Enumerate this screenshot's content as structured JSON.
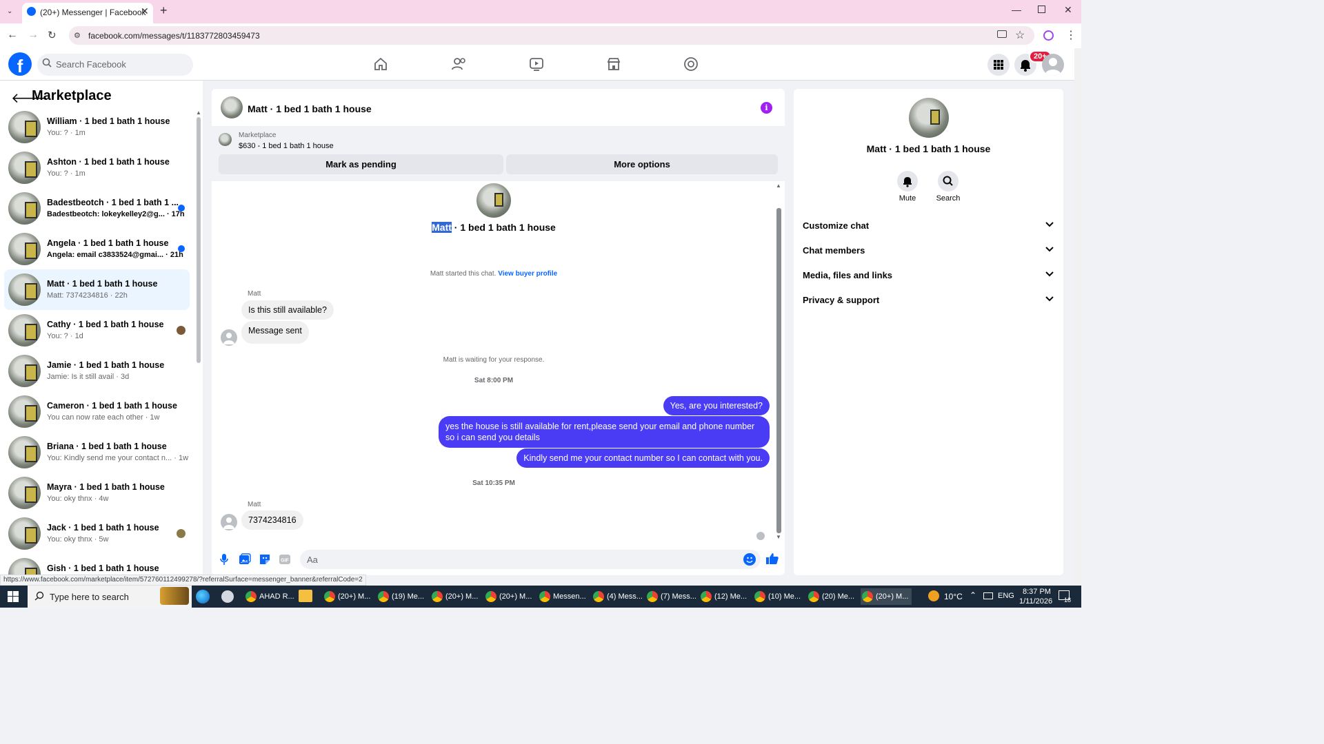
{
  "browser": {
    "tab_title": "(20+) Messenger | Facebook",
    "url": "facebook.com/messages/t/1183772803459473",
    "status_url": "https://www.facebook.com/marketplace/item/572760112499278/?referralSurface=messenger_banner&referralCode=2"
  },
  "header": {
    "search_placeholder": "Search Facebook",
    "notification_badge": "20+"
  },
  "sidebar": {
    "title": "Marketplace",
    "conversations": [
      {
        "name": "William · 1 bed 1 bath 1 house",
        "snippet": "You: ? · 1m",
        "unread": false
      },
      {
        "name": "Ashton · 1 bed 1 bath 1 house",
        "snippet": "You: ? · 1m",
        "unread": false
      },
      {
        "name": "Badestbeotch · 1 bed 1 bath 1 ...",
        "snippet": "Badestbeotch: lokeykelley2@g... · 17h",
        "unread": true
      },
      {
        "name": "Angela · 1 bed 1 bath 1 house",
        "snippet": "Angela: email c3833524@gmai... · 21h",
        "unread": true
      },
      {
        "name": "Matt · 1 bed 1 bath 1 house",
        "snippet": "Matt: 7374234816 · 22h",
        "unread": false
      },
      {
        "name": "Cathy · 1 bed 1 bath 1 house",
        "snippet": "You: ? · 1d",
        "unread": false
      },
      {
        "name": "Jamie · 1 bed 1 bath 1 house",
        "snippet": "Jamie: Is it still avail · 3d",
        "unread": false
      },
      {
        "name": "Cameron · 1 bed 1 bath 1 house",
        "snippet": "You can now rate each other · 1w",
        "unread": false
      },
      {
        "name": "Briana · 1 bed 1 bath 1 house",
        "snippet": "You: Kindly send me your contact n... · 1w",
        "unread": false
      },
      {
        "name": "Mayra · 1 bed 1 bath 1 house",
        "snippet": "You: oky thnx · 4w",
        "unread": false
      },
      {
        "name": "Jack · 1 bed 1 bath 1 house",
        "snippet": "You: oky thnx · 5w",
        "unread": false
      },
      {
        "name": "Gish · 1 bed 1 bath 1 house",
        "snippet": "",
        "unread": false
      }
    ]
  },
  "chat": {
    "title": "Matt · 1 bed 1 bath 1 house",
    "banner_label": "Marketplace",
    "banner_price": "$630 - 1 bed 1 bath 1 house",
    "btn_pending": "Mark as pending",
    "btn_more": "More options",
    "center_name_highlight": "Matt",
    "center_name_rest": " · 1 bed 1 bath 1 house",
    "started": "Matt started this chat.",
    "view_profile": "View buyer profile",
    "sender1": "Matt",
    "msg1": "Is this still available?",
    "msg2": "Message sent",
    "waiting": "Matt is waiting for your response.",
    "time1": "Sat 8:00 PM",
    "out1": "Yes, are you interested?",
    "out2": "yes the house is still available for rent,please send your email and phone number so i can send you details",
    "out3": "Kindly send me your contact number so I can contact with you.",
    "time2": "Sat 10:35 PM",
    "sender2": "Matt",
    "msg3": "7374234816",
    "compose_placeholder": "Aa"
  },
  "info_panel": {
    "name": "Matt · 1 bed 1 bath 1 house",
    "mute": "Mute",
    "search": "Search",
    "sections": [
      "Customize chat",
      "Chat members",
      "Media, files and links",
      "Privacy & support"
    ]
  },
  "taskbar": {
    "search_placeholder": "Type here to search",
    "items": [
      "AHAD R...",
      "(20+) M...",
      "(19) Me...",
      "(20+) M...",
      "(20+) M...",
      "Messen...",
      "(4) Mess...",
      "(7) Mess...",
      "(12) Me...",
      "(10) Me...",
      "(20) Me...",
      "(20+) M..."
    ],
    "temperature": "10°C",
    "lang": "ENG",
    "time": "8:37 PM",
    "date": "1/11/2026",
    "notif_count": "18"
  },
  "colors": {
    "fb_blue": "#0866ff",
    "outgoing_bubble": "#4a3cf5",
    "info_purple": "#a020f0"
  }
}
